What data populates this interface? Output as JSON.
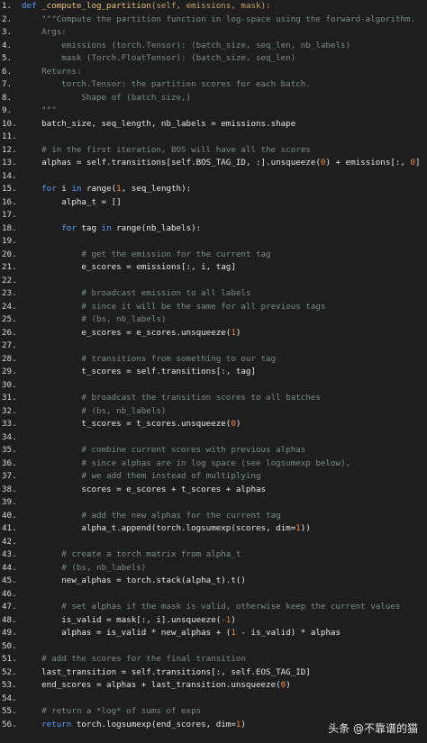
{
  "code": {
    "lines": [
      {
        "no": "1.",
        "parts": [
          [
            "kw",
            "def "
          ],
          [
            "fn",
            "_compute_log_partition"
          ],
          [
            "str",
            "(self, emissions, mask):"
          ]
        ]
      },
      {
        "no": "2.",
        "parts": [
          [
            "cm",
            "    \"\"\"Compute the partition function in log-space using the forward-algorithm."
          ]
        ]
      },
      {
        "no": "3.",
        "parts": [
          [
            "cm",
            "    Args:"
          ]
        ]
      },
      {
        "no": "4.",
        "parts": [
          [
            "cm",
            "        emissions (torch.Tensor): (batch_size, seq_len, nb_labels)"
          ]
        ]
      },
      {
        "no": "5.",
        "parts": [
          [
            "cm",
            "        mask (Torch.FloatTensor): (batch_size, seq_len)"
          ]
        ]
      },
      {
        "no": "6.",
        "parts": [
          [
            "cm",
            "    Returns:"
          ]
        ]
      },
      {
        "no": "7.",
        "parts": [
          [
            "cm",
            "        torch.Tensor: the partition scores for each batch."
          ]
        ]
      },
      {
        "no": "8.",
        "parts": [
          [
            "cm",
            "            Shape of (batch_size,)"
          ]
        ]
      },
      {
        "no": "9.",
        "parts": [
          [
            "cm",
            "    \"\"\""
          ]
        ]
      },
      {
        "no": "10.",
        "parts": [
          [
            "txt",
            "    batch_size, seq_length, nb_labels = emissions.shape"
          ]
        ]
      },
      {
        "no": "11.",
        "parts": [
          [
            "txt",
            ""
          ]
        ]
      },
      {
        "no": "12.",
        "parts": [
          [
            "cm",
            "    # in the first iteration, BOS will have all the scores"
          ]
        ]
      },
      {
        "no": "13.",
        "parts": [
          [
            "txt",
            "    alphas = self.transitions[self.BOS_TAG_ID, :].unsqueeze("
          ],
          [
            "num",
            "0"
          ],
          [
            "txt",
            ") + emissions[:, "
          ],
          [
            "num",
            "0"
          ],
          [
            "txt",
            "]"
          ]
        ]
      },
      {
        "no": "14.",
        "parts": [
          [
            "txt",
            ""
          ]
        ]
      },
      {
        "no": "15.",
        "parts": [
          [
            "kw",
            "    for "
          ],
          [
            "txt",
            "i "
          ],
          [
            "kw",
            "in "
          ],
          [
            "txt",
            "range("
          ],
          [
            "num",
            "1"
          ],
          [
            "txt",
            ", seq_length):"
          ]
        ]
      },
      {
        "no": "16.",
        "parts": [
          [
            "txt",
            "        alpha_t = []"
          ]
        ]
      },
      {
        "no": "17.",
        "parts": [
          [
            "txt",
            ""
          ]
        ]
      },
      {
        "no": "18.",
        "parts": [
          [
            "kw",
            "        for "
          ],
          [
            "txt",
            "tag "
          ],
          [
            "kw",
            "in "
          ],
          [
            "txt",
            "range(nb_labels):"
          ]
        ]
      },
      {
        "no": "19.",
        "parts": [
          [
            "txt",
            ""
          ]
        ]
      },
      {
        "no": "20.",
        "parts": [
          [
            "cm",
            "            # get the emission for the current tag"
          ]
        ]
      },
      {
        "no": "21.",
        "parts": [
          [
            "txt",
            "            e_scores = emissions[:, i, tag]"
          ]
        ]
      },
      {
        "no": "22.",
        "parts": [
          [
            "txt",
            ""
          ]
        ]
      },
      {
        "no": "23.",
        "parts": [
          [
            "cm",
            "            # broadcast emission to all labels"
          ]
        ]
      },
      {
        "no": "24.",
        "parts": [
          [
            "cm",
            "            # since it will be the same for all previous tags"
          ]
        ]
      },
      {
        "no": "25.",
        "parts": [
          [
            "cm",
            "            # (bs, nb_labels)"
          ]
        ]
      },
      {
        "no": "26.",
        "parts": [
          [
            "txt",
            "            e_scores = e_scores.unsqueeze("
          ],
          [
            "num",
            "1"
          ],
          [
            "txt",
            ")"
          ]
        ]
      },
      {
        "no": "27.",
        "parts": [
          [
            "txt",
            ""
          ]
        ]
      },
      {
        "no": "28.",
        "parts": [
          [
            "cm",
            "            # transitions from something to our tag"
          ]
        ]
      },
      {
        "no": "29.",
        "parts": [
          [
            "txt",
            "            t_scores = self.transitions[:, tag]"
          ]
        ]
      },
      {
        "no": "30.",
        "parts": [
          [
            "txt",
            ""
          ]
        ]
      },
      {
        "no": "31.",
        "parts": [
          [
            "cm",
            "            # broadcast the transition scores to all batches"
          ]
        ]
      },
      {
        "no": "32.",
        "parts": [
          [
            "cm",
            "            # (bs, nb_labels)"
          ]
        ]
      },
      {
        "no": "33.",
        "parts": [
          [
            "txt",
            "            t_scores = t_scores.unsqueeze("
          ],
          [
            "num",
            "0"
          ],
          [
            "txt",
            ")"
          ]
        ]
      },
      {
        "no": "34.",
        "parts": [
          [
            "txt",
            ""
          ]
        ]
      },
      {
        "no": "35.",
        "parts": [
          [
            "cm",
            "            # combine current scores with previous alphas"
          ]
        ]
      },
      {
        "no": "36.",
        "parts": [
          [
            "cm",
            "            # since alphas are in log space (see logsumexp below),"
          ]
        ]
      },
      {
        "no": "37.",
        "parts": [
          [
            "cm",
            "            # we add them instead of multiplying"
          ]
        ]
      },
      {
        "no": "38.",
        "parts": [
          [
            "txt",
            "            scores = e_scores + t_scores + alphas"
          ]
        ]
      },
      {
        "no": "39.",
        "parts": [
          [
            "txt",
            ""
          ]
        ]
      },
      {
        "no": "40.",
        "parts": [
          [
            "cm",
            "            # add the new alphas for the current tag"
          ]
        ]
      },
      {
        "no": "41.",
        "parts": [
          [
            "txt",
            "            alpha_t.append(torch.logsumexp(scores, dim="
          ],
          [
            "num",
            "1"
          ],
          [
            "txt",
            "))"
          ]
        ]
      },
      {
        "no": "42.",
        "parts": [
          [
            "txt",
            ""
          ]
        ]
      },
      {
        "no": "43.",
        "parts": [
          [
            "cm",
            "        # create a torch matrix from alpha_t"
          ]
        ]
      },
      {
        "no": "44.",
        "parts": [
          [
            "cm",
            "        # (bs, nb_labels)"
          ]
        ]
      },
      {
        "no": "45.",
        "parts": [
          [
            "txt",
            "        new_alphas = torch.stack(alpha_t).t()"
          ]
        ]
      },
      {
        "no": "46.",
        "parts": [
          [
            "txt",
            ""
          ]
        ]
      },
      {
        "no": "47.",
        "parts": [
          [
            "cm",
            "        # set alphas if the mask is valid, otherwise keep the current values"
          ]
        ]
      },
      {
        "no": "48.",
        "parts": [
          [
            "txt",
            "        is_valid = mask[:, i].unsqueeze("
          ],
          [
            "num",
            "-1"
          ],
          [
            "txt",
            ")"
          ]
        ]
      },
      {
        "no": "49.",
        "parts": [
          [
            "txt",
            "        alphas = is_valid * new_alphas + ("
          ],
          [
            "num",
            "1"
          ],
          [
            "txt",
            " - is_valid) * alphas"
          ]
        ]
      },
      {
        "no": "50.",
        "parts": [
          [
            "txt",
            ""
          ]
        ]
      },
      {
        "no": "51.",
        "parts": [
          [
            "cm",
            "    # add the scores for the final transition"
          ]
        ]
      },
      {
        "no": "52.",
        "parts": [
          [
            "txt",
            "    last_transition = self.transitions[:, self.EOS_TAG_ID]"
          ]
        ]
      },
      {
        "no": "53.",
        "parts": [
          [
            "txt",
            "    end_scores = alphas + last_transition.unsqueeze("
          ],
          [
            "num",
            "0"
          ],
          [
            "txt",
            ")"
          ]
        ]
      },
      {
        "no": "54.",
        "parts": [
          [
            "txt",
            ""
          ]
        ]
      },
      {
        "no": "55.",
        "parts": [
          [
            "cm",
            "    # return a *log* of sums of exps"
          ]
        ]
      },
      {
        "no": "56.",
        "parts": [
          [
            "kw",
            "    return "
          ],
          [
            "txt",
            "torch.logsumexp(end_scores, dim="
          ],
          [
            "num",
            "1"
          ],
          [
            "txt",
            ")"
          ]
        ]
      }
    ]
  },
  "watermark": {
    "text": "头条 @不靠谱的猫"
  },
  "colors": {
    "background": "#1e1e1e",
    "keyword": "#5c9cf5",
    "function": "#f0c674",
    "comment": "#7d8a8a",
    "number": "#f08c4a",
    "text": "#e6e6e6"
  }
}
